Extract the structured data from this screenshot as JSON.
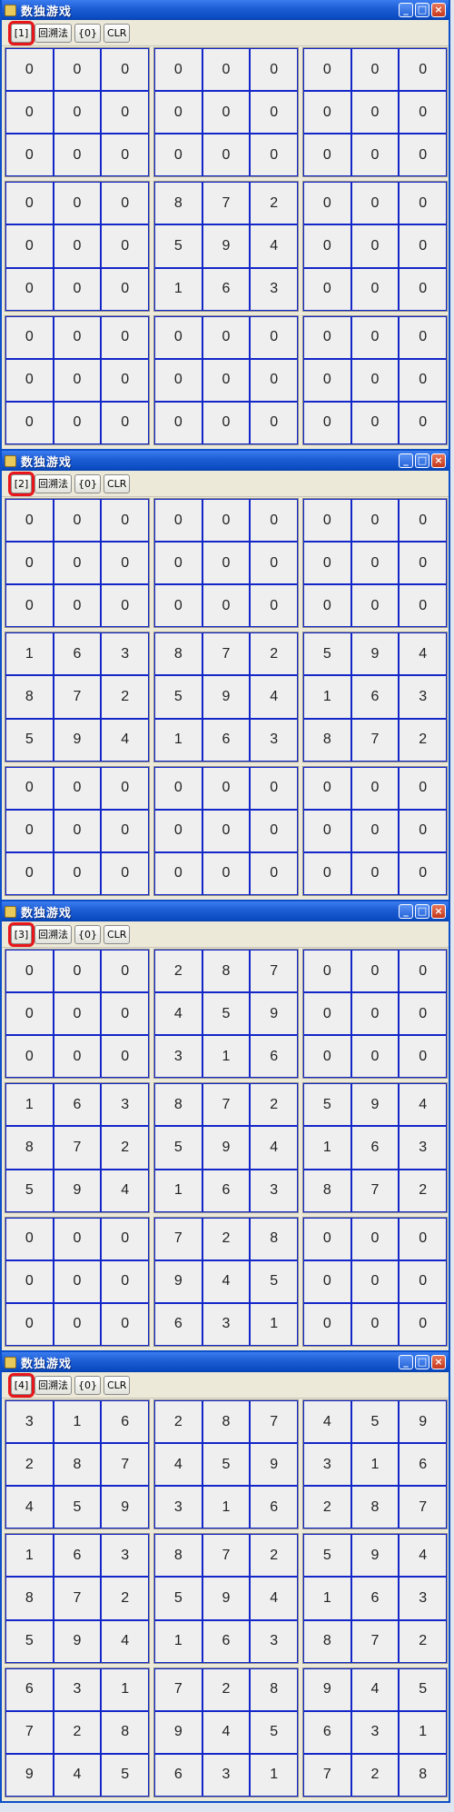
{
  "window": {
    "title": "数独游戏",
    "minimize_label": "_",
    "maximize_label": "□",
    "close_label": "×"
  },
  "toolbar": {
    "backtrack_label": "回溯法",
    "zero_label": "{0}",
    "clear_label": "CLR"
  },
  "snapshots": [
    {
      "step_label": "[1]",
      "grid": [
        [
          0,
          0,
          0,
          0,
          0,
          0,
          0,
          0,
          0
        ],
        [
          0,
          0,
          0,
          0,
          0,
          0,
          0,
          0,
          0
        ],
        [
          0,
          0,
          0,
          0,
          0,
          0,
          0,
          0,
          0
        ],
        [
          0,
          0,
          0,
          8,
          7,
          2,
          0,
          0,
          0
        ],
        [
          0,
          0,
          0,
          5,
          9,
          4,
          0,
          0,
          0
        ],
        [
          0,
          0,
          0,
          1,
          6,
          3,
          0,
          0,
          0
        ],
        [
          0,
          0,
          0,
          0,
          0,
          0,
          0,
          0,
          0
        ],
        [
          0,
          0,
          0,
          0,
          0,
          0,
          0,
          0,
          0
        ],
        [
          0,
          0,
          0,
          0,
          0,
          0,
          0,
          0,
          0
        ]
      ]
    },
    {
      "step_label": "[2]",
      "grid": [
        [
          0,
          0,
          0,
          0,
          0,
          0,
          0,
          0,
          0
        ],
        [
          0,
          0,
          0,
          0,
          0,
          0,
          0,
          0,
          0
        ],
        [
          0,
          0,
          0,
          0,
          0,
          0,
          0,
          0,
          0
        ],
        [
          1,
          6,
          3,
          8,
          7,
          2,
          5,
          9,
          4
        ],
        [
          8,
          7,
          2,
          5,
          9,
          4,
          1,
          6,
          3
        ],
        [
          5,
          9,
          4,
          1,
          6,
          3,
          8,
          7,
          2
        ],
        [
          0,
          0,
          0,
          0,
          0,
          0,
          0,
          0,
          0
        ],
        [
          0,
          0,
          0,
          0,
          0,
          0,
          0,
          0,
          0
        ],
        [
          0,
          0,
          0,
          0,
          0,
          0,
          0,
          0,
          0
        ]
      ]
    },
    {
      "step_label": "[3]",
      "grid": [
        [
          0,
          0,
          0,
          2,
          8,
          7,
          0,
          0,
          0
        ],
        [
          0,
          0,
          0,
          4,
          5,
          9,
          0,
          0,
          0
        ],
        [
          0,
          0,
          0,
          3,
          1,
          6,
          0,
          0,
          0
        ],
        [
          1,
          6,
          3,
          8,
          7,
          2,
          5,
          9,
          4
        ],
        [
          8,
          7,
          2,
          5,
          9,
          4,
          1,
          6,
          3
        ],
        [
          5,
          9,
          4,
          1,
          6,
          3,
          8,
          7,
          2
        ],
        [
          0,
          0,
          0,
          7,
          2,
          8,
          0,
          0,
          0
        ],
        [
          0,
          0,
          0,
          9,
          4,
          5,
          0,
          0,
          0
        ],
        [
          0,
          0,
          0,
          6,
          3,
          1,
          0,
          0,
          0
        ]
      ]
    },
    {
      "step_label": "[4]",
      "grid": [
        [
          3,
          1,
          6,
          2,
          8,
          7,
          4,
          5,
          9
        ],
        [
          2,
          8,
          7,
          4,
          5,
          9,
          3,
          1,
          6
        ],
        [
          4,
          5,
          9,
          3,
          1,
          6,
          2,
          8,
          7
        ],
        [
          1,
          6,
          3,
          8,
          7,
          2,
          5,
          9,
          4
        ],
        [
          8,
          7,
          2,
          5,
          9,
          4,
          1,
          6,
          3
        ],
        [
          5,
          9,
          4,
          1,
          6,
          3,
          8,
          7,
          2
        ],
        [
          6,
          3,
          1,
          7,
          2,
          8,
          9,
          4,
          5
        ],
        [
          7,
          2,
          8,
          9,
          4,
          5,
          6,
          3,
          1
        ],
        [
          9,
          4,
          5,
          6,
          3,
          1,
          7,
          2,
          8
        ]
      ]
    }
  ],
  "colors": {
    "cell_border": "#1326c8",
    "highlight": "#e8161a",
    "title_bar": "#1f5fd6"
  }
}
